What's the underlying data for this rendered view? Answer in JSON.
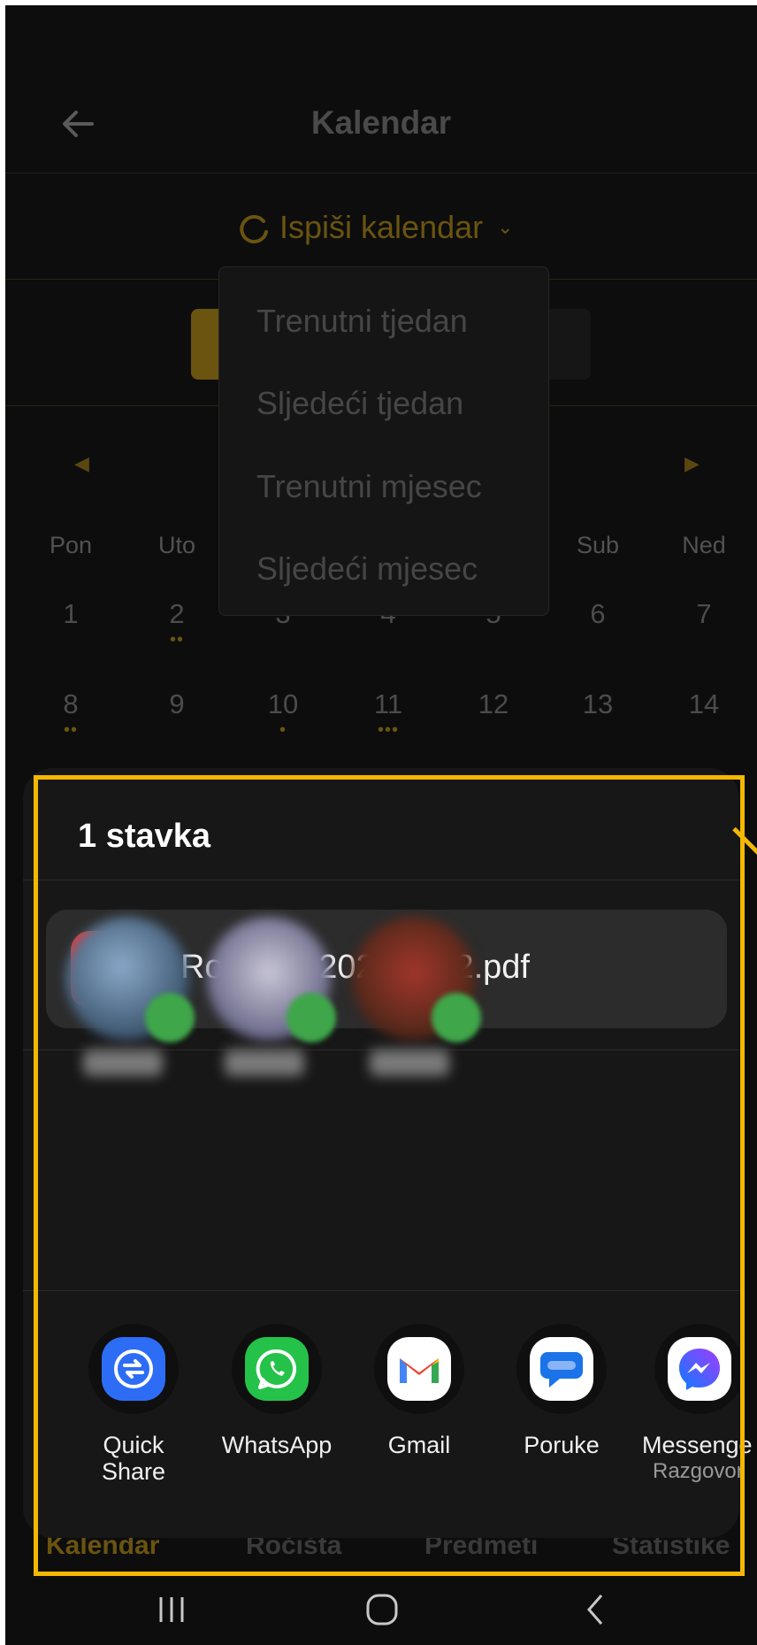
{
  "app": {
    "title": "Kalendar",
    "print_button": "Ispiši kalendar",
    "print_menu": [
      "Trenutni tjedan",
      "Sljedeći tjedan",
      "Trenutni mjesec",
      "Sljedeći mjesec"
    ],
    "weekdays": [
      "Pon",
      "Uto",
      "Sub",
      "Ned"
    ],
    "week1": [
      "1",
      "2",
      "3",
      "4",
      "5",
      "6",
      "7"
    ],
    "week2": [
      "8",
      "9",
      "10",
      "11",
      "12",
      "13",
      "14"
    ],
    "bottom_tabs": [
      "Kalendar",
      "Ročišta",
      "Predmeti",
      "Statistike"
    ],
    "accent_color": "#6a5410"
  },
  "share_sheet": {
    "title": "1 stavka",
    "file_name": "Rocisnik-2025-W52.pdf",
    "file_icon": "pdf-icon",
    "targets": [
      {
        "label": "Quick Share",
        "icon": "quick-share-icon"
      },
      {
        "label": "WhatsApp",
        "icon": "whatsapp-icon"
      },
      {
        "label": "Gmail",
        "icon": "gmail-icon"
      },
      {
        "label": "Poruke",
        "icon": "messages-icon"
      },
      {
        "label": "Messenge",
        "sub": "Razgovor",
        "icon": "messenger-icon"
      }
    ],
    "highlight_color": "#f4b800"
  }
}
